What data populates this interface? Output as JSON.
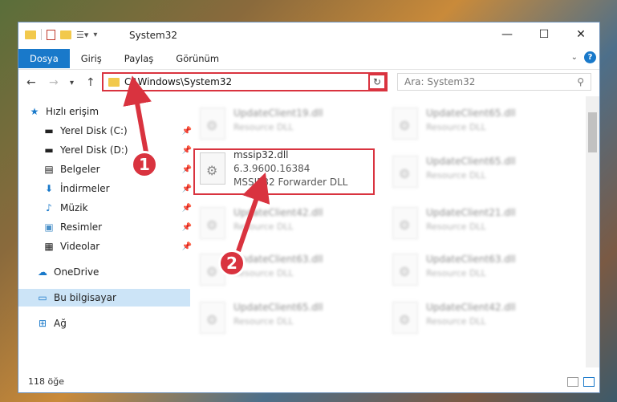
{
  "window": {
    "title": "System32",
    "controls": [
      "—",
      "☐",
      "✕"
    ]
  },
  "ribbon": {
    "tabs": [
      "Dosya",
      "Giriş",
      "Paylaş",
      "Görünüm"
    ],
    "active_tab": "Dosya"
  },
  "navbar": {
    "address": "C:\\Windows\\System32",
    "search_placeholder": "Ara: System32"
  },
  "sidebar": {
    "quick_access": "Hızlı erişim",
    "items": [
      {
        "label": "Yerel Disk (C:)",
        "icon": "drive-icon",
        "pinned": true
      },
      {
        "label": "Yerel Disk (D:)",
        "icon": "drive-icon",
        "pinned": true
      },
      {
        "label": "Belgeler",
        "icon": "documents-icon",
        "pinned": true
      },
      {
        "label": "İndirmeler",
        "icon": "downloads-icon",
        "pinned": true
      },
      {
        "label": "Müzik",
        "icon": "music-icon",
        "pinned": true
      },
      {
        "label": "Resimler",
        "icon": "pictures-icon",
        "pinned": true
      },
      {
        "label": "Videolar",
        "icon": "videos-icon",
        "pinned": true
      }
    ],
    "onedrive": "OneDrive",
    "this_pc": "Bu bilgisayar",
    "network": "Ağ"
  },
  "files": {
    "left": [
      {
        "name": "UpdateClient19.dll",
        "desc": "Resource DLL"
      },
      {
        "name": "UpdateClient42.dll",
        "desc": "Resource DLL"
      },
      {
        "name": "UpdateClient63.dll",
        "desc": "Resource DLL"
      },
      {
        "name": "UpdateClient65.dll",
        "desc": "Resource DLL"
      }
    ],
    "right": [
      {
        "name": "UpdateClient65.dll",
        "desc": "Resource DLL"
      },
      {
        "name": "UpdateClient65.dll",
        "desc": "Resource DLL"
      },
      {
        "name": "UpdateClient21.dll",
        "desc": "Resource DLL"
      },
      {
        "name": "UpdateClient63.dll",
        "desc": "Resource DLL"
      },
      {
        "name": "UpdateClient42.dll",
        "desc": "Resource DLL"
      }
    ],
    "selected": {
      "name": "mssip32.dll",
      "version": "6.3.9600.16384",
      "desc": "MSSIP32 Forwarder DLL"
    }
  },
  "status": {
    "item_count": "118 öğe"
  },
  "annotations": {
    "step1": "1",
    "step2": "2",
    "color": "#d9333f"
  }
}
